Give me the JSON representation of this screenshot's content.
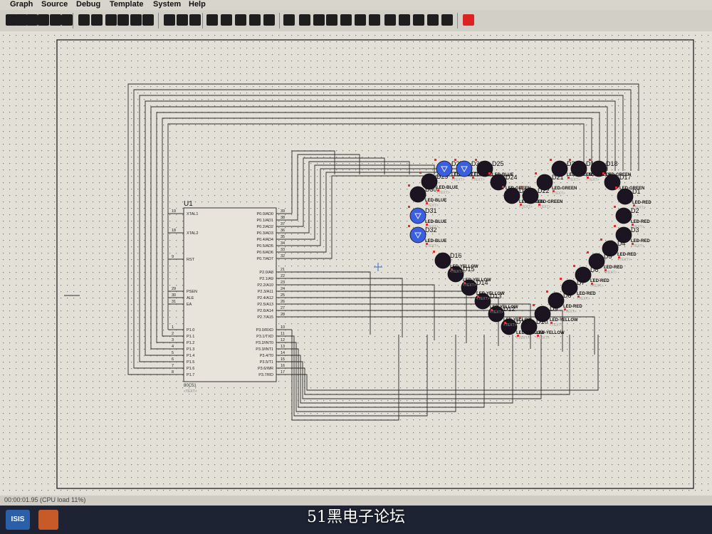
{
  "menu": [
    "Graph",
    "Source",
    "Debug",
    "Template",
    "System",
    "Help"
  ],
  "mcu": {
    "ref": "U1",
    "part": "80C51",
    "text_placeholder": "<TEXT>",
    "left_pins": [
      {
        "num": "19",
        "name": "XTAL1"
      },
      {
        "num": "18",
        "name": "XTAL2"
      },
      {
        "num": "9",
        "name": "RST"
      },
      {
        "num": "29",
        "name": "PSEN"
      },
      {
        "num": "30",
        "name": "ALE"
      },
      {
        "num": "31",
        "name": "EA"
      },
      {
        "num": "1",
        "name": "P1.0"
      },
      {
        "num": "2",
        "name": "P1.1"
      },
      {
        "num": "3",
        "name": "P1.2"
      },
      {
        "num": "4",
        "name": "P1.3"
      },
      {
        "num": "5",
        "name": "P1.4"
      },
      {
        "num": "6",
        "name": "P1.5"
      },
      {
        "num": "7",
        "name": "P1.6"
      },
      {
        "num": "8",
        "name": "P1.7"
      }
    ],
    "right_pins": [
      {
        "num": "39",
        "name": "P0.0/AD0"
      },
      {
        "num": "38",
        "name": "P0.1/AD1"
      },
      {
        "num": "37",
        "name": "P0.2/AD2"
      },
      {
        "num": "36",
        "name": "P0.3/AD3"
      },
      {
        "num": "35",
        "name": "P0.4/AD4"
      },
      {
        "num": "34",
        "name": "P0.5/AD5"
      },
      {
        "num": "33",
        "name": "P0.6/AD6"
      },
      {
        "num": "32",
        "name": "P0.7/AD7"
      },
      {
        "num": "21",
        "name": "P2.0/A8"
      },
      {
        "num": "22",
        "name": "P2.1/A9"
      },
      {
        "num": "23",
        "name": "P2.2/A10"
      },
      {
        "num": "24",
        "name": "P2.3/A11"
      },
      {
        "num": "25",
        "name": "P2.4/A12"
      },
      {
        "num": "26",
        "name": "P2.5/A13"
      },
      {
        "num": "27",
        "name": "P2.6/A14"
      },
      {
        "num": "28",
        "name": "P2.7/A15"
      },
      {
        "num": "10",
        "name": "P3.0/RXD"
      },
      {
        "num": "11",
        "name": "P3.1/TXD"
      },
      {
        "num": "12",
        "name": "P3.2/INT0"
      },
      {
        "num": "13",
        "name": "P3.3/INT1"
      },
      {
        "num": "14",
        "name": "P3.4/T0"
      },
      {
        "num": "15",
        "name": "P3.5/T1"
      },
      {
        "num": "16",
        "name": "P3.6/WR"
      },
      {
        "num": "17",
        "name": "P3.7/RD"
      }
    ]
  },
  "leds": [
    {
      "ref": "D32",
      "color": "blue",
      "lit": true,
      "type": "LED-BLUE"
    },
    {
      "ref": "D31",
      "color": "blue",
      "lit": true,
      "type": "LED-BLUE"
    },
    {
      "ref": "D30",
      "color": "blue",
      "lit": false,
      "type": "LED-BLUE"
    },
    {
      "ref": "D29",
      "color": "blue",
      "lit": false,
      "type": "LED-BLUE"
    },
    {
      "ref": "D27",
      "color": "blue",
      "lit": true,
      "type": "LED-BLUE"
    },
    {
      "ref": "D26",
      "color": "blue",
      "lit": true,
      "type": "LED-BLUE"
    },
    {
      "ref": "D25",
      "color": "blue",
      "lit": false,
      "type": "LED-BLUE"
    },
    {
      "ref": "D24",
      "color": "green",
      "lit": false,
      "type": "LED-GREEN"
    },
    {
      "ref": "D23",
      "color": "green",
      "lit": false,
      "type": "LED-GREEN"
    },
    {
      "ref": "D22",
      "color": "green",
      "lit": false,
      "type": "LED-GREEN"
    },
    {
      "ref": "D21",
      "color": "green",
      "lit": false,
      "type": "LED-GREEN"
    },
    {
      "ref": "D20",
      "color": "green",
      "lit": false,
      "type": "LED-GREEN"
    },
    {
      "ref": "D19",
      "color": "green",
      "lit": false,
      "type": "LED-GREEN"
    },
    {
      "ref": "D18",
      "color": "green",
      "lit": false,
      "type": "LED-GREEN"
    },
    {
      "ref": "D17",
      "color": "green",
      "lit": false,
      "type": "LED-GREEN"
    },
    {
      "ref": "D1",
      "color": "red",
      "lit": false,
      "type": "LED-RED"
    },
    {
      "ref": "D2",
      "color": "red",
      "lit": false,
      "type": "LED-RED"
    },
    {
      "ref": "D3",
      "color": "red",
      "lit": false,
      "type": "LED-RED"
    },
    {
      "ref": "D4",
      "color": "red",
      "lit": false,
      "type": "LED-RED"
    },
    {
      "ref": "D5",
      "color": "red",
      "lit": false,
      "type": "LED-RED"
    },
    {
      "ref": "D6",
      "color": "red",
      "lit": false,
      "type": "LED-RED"
    },
    {
      "ref": "D7",
      "color": "red",
      "lit": false,
      "type": "LED-RED"
    },
    {
      "ref": "D8",
      "color": "red",
      "lit": false,
      "type": "LED-RED"
    },
    {
      "ref": "D9",
      "color": "yellow",
      "lit": false,
      "type": "LED-YELLOW"
    },
    {
      "ref": "D10",
      "color": "yellow",
      "lit": false,
      "type": "LED-YELLOW"
    },
    {
      "ref": "D11",
      "color": "yellow",
      "lit": false,
      "type": "LED-YELLOW"
    },
    {
      "ref": "D12",
      "color": "yellow",
      "lit": false,
      "type": "LED-YELLOW"
    },
    {
      "ref": "D13",
      "color": "yellow",
      "lit": false,
      "type": "LED-YELLOW"
    },
    {
      "ref": "D14",
      "color": "yellow",
      "lit": false,
      "type": "LED-YELLOW"
    },
    {
      "ref": "D15",
      "color": "yellow",
      "lit": false,
      "type": "LED-YELLOW"
    },
    {
      "ref": "D16",
      "color": "yellow",
      "lit": false,
      "type": "LED-YELLOW"
    }
  ],
  "status": "00:00:01.95 (CPU load 11%)",
  "watermark": "51黑电子论坛",
  "taskbar_app": "ISIS",
  "colors": {
    "lit_led": "#3a5ee0",
    "off_led": "#1c1420",
    "wire": "#2c2c2c",
    "border": "#222222",
    "pin_marker": "#e03030"
  }
}
